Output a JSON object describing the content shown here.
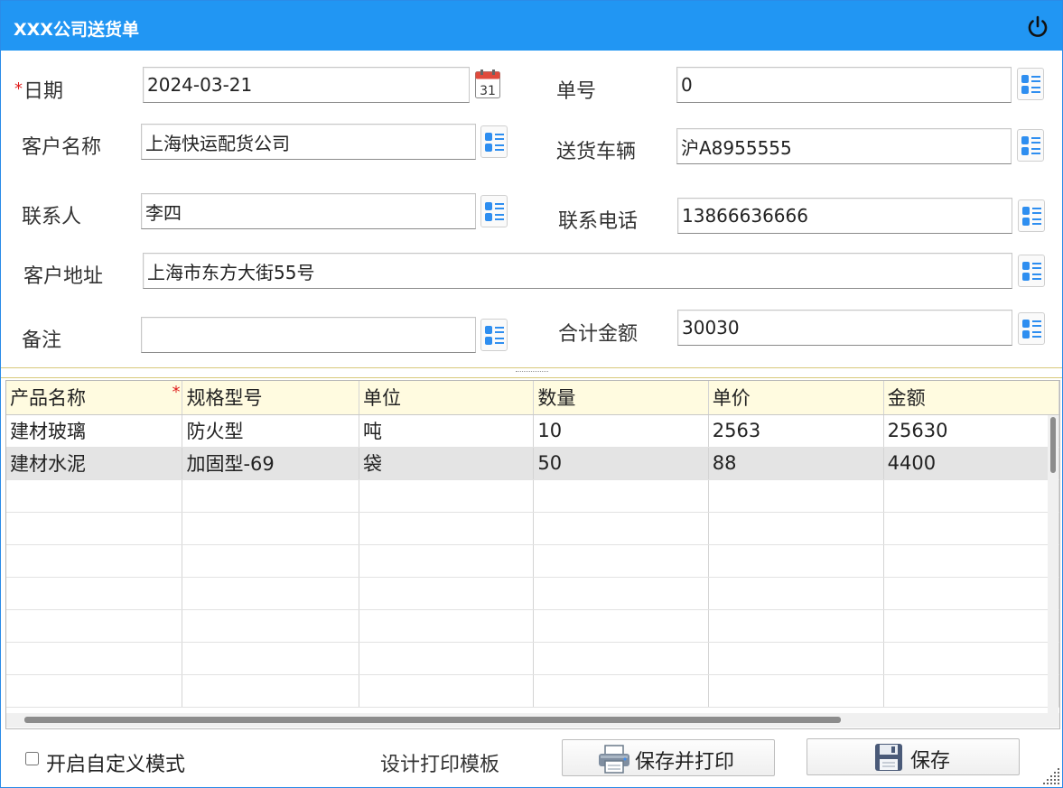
{
  "window": {
    "title": "XXX公司送货单"
  },
  "form": {
    "date": {
      "label": "日期",
      "required_mark": "*",
      "value": "2024-03-21",
      "calendar_day": "31"
    },
    "order_no": {
      "label": "单号",
      "value": "0"
    },
    "customer_name": {
      "label": "客户名称",
      "value": "上海快运配货公司"
    },
    "vehicle": {
      "label": "送货车辆",
      "value": "沪A8955555"
    },
    "contact": {
      "label": "联系人",
      "value": "李四"
    },
    "phone": {
      "label": "联系电话",
      "value": "13866636666"
    },
    "address": {
      "label": "客户地址",
      "value": "上海市东方大街55号"
    },
    "remark": {
      "label": "备注",
      "value": ""
    },
    "total": {
      "label": "合计金额",
      "value": "30030"
    }
  },
  "grid": {
    "columns": [
      "产品名称",
      "规格型号",
      "单位",
      "数量",
      "单价",
      "金额"
    ],
    "required_mark": "*",
    "rows": [
      [
        "建材玻璃",
        "防火型",
        "吨",
        "10",
        "2563",
        "25630"
      ],
      [
        "建材水泥",
        "加固型-69",
        "袋",
        "50",
        "88",
        "4400"
      ]
    ],
    "selected_row": 1,
    "empty_rows": 7
  },
  "footer": {
    "custom_mode_label": "开启自定义模式",
    "custom_mode_checked": false,
    "design_template_label": "设计打印模板",
    "save_print_label": "保存并打印",
    "save_label": "保存"
  },
  "colors": {
    "titlebar": "#2196f3",
    "header_bg": "#fffbe0",
    "selected_row": "#e4e4e4",
    "picker_icon": "#2e8ef0"
  }
}
